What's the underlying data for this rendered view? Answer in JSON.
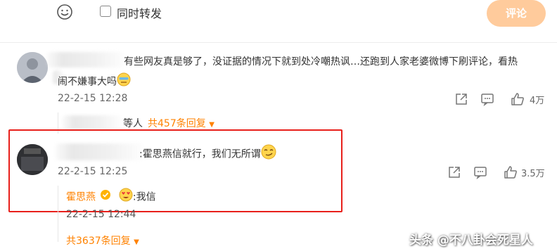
{
  "composer": {
    "repost_label": "同时转发",
    "submit_label": "评论"
  },
  "comment1": {
    "text_line1": "有些网友真是够了，没证据的情况下就到处冷嘲热讽…还跑到人家老婆微博下刷评论，看热",
    "text_line2": "闹不嫌事大吗",
    "time": "22-2-15 12:28",
    "likes": "4万",
    "replies_tail": "等人",
    "replies_link": "共457条回复"
  },
  "comment2": {
    "text": ":霍思燕信就行，我们无所谓",
    "time": "22-2-15 12:25",
    "likes": "3.5万",
    "reply": {
      "author": "霍思燕",
      "text": ":我信",
      "time": "22-2-15 12:44"
    },
    "replies_link": "共3637条回复"
  },
  "watermark": "头条 @不八卦会死星人",
  "colors": {
    "accent": "#ff8200",
    "highlight_box": "#e8201b",
    "button": "#ffcb9c"
  }
}
